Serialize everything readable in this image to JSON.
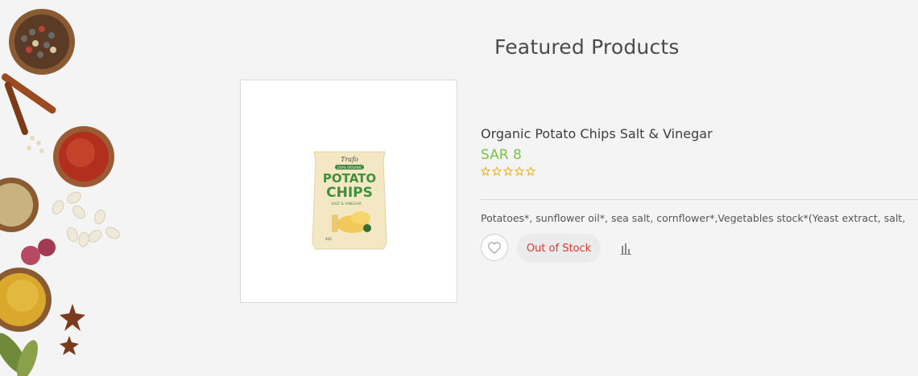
{
  "section": {
    "title": "Featured Products"
  },
  "product": {
    "name": "Organic Potato Chips Salt & Vinegar",
    "price": "SAR 8",
    "rating": {
      "value": 0,
      "max": 5
    },
    "description": "Potatoes*, sunflower oil*, sea salt, cornflower*,Vegetables stock*(Yeast extract, salt,",
    "stock_status": "Out of Stock",
    "image_alt": "Organic Potato Chips Salt & Vinegar"
  },
  "pack": {
    "brand": "Trafo",
    "badge": "100% ORGANIC",
    "line1": "POTATO",
    "line2": "CHIPS",
    "flavor": "SALT & VINEGAR",
    "weight": "40G"
  },
  "icons": {
    "wishlist": "heart-icon",
    "compare": "bar-chart-icon",
    "star": "star-outline-icon"
  },
  "colors": {
    "price": "#7cc242",
    "stock": "#e0362c",
    "star": "#f2b01e",
    "title": "#4a4a4a"
  }
}
